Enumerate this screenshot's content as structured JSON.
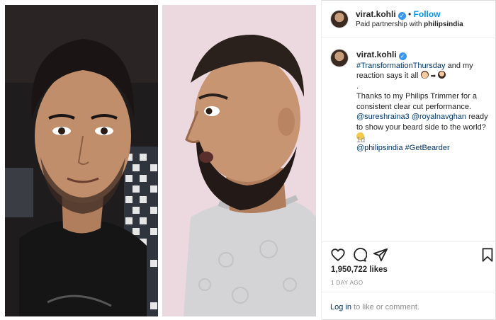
{
  "post": {
    "author": "virat.kohli",
    "follow_label": "Follow",
    "partnership_prefix": "Paid partnership with ",
    "partner": "philipsindia"
  },
  "caption": {
    "author": "virat.kohli",
    "hashtag_1": "#TransformationThursday",
    "line_1": "and my reaction says it all",
    "arrow": "➡",
    "dot": ".",
    "body": "Thanks to my Philips Trimmer for a consistent clear cut performance.",
    "mention_1": "@sureshraina3",
    "mention_2": "@royalnavghan",
    "body_2": "ready to show your beard side to the world?",
    "mention_3": "@philipsindia",
    "hashtag_2": "#GetBearder",
    "time_ago": "1d"
  },
  "engagement": {
    "likes": "1,950,722 likes",
    "date": "1 DAY AGO",
    "login_link": "Log in",
    "login_suffix": " to like or comment."
  },
  "colors": {
    "link_blue": "#0095f6",
    "verified": "#3897f0",
    "muted": "#8e8e8e",
    "right_photo_bg": "#ecd9e0"
  },
  "icons": [
    "heart-icon",
    "comment-icon",
    "share-icon",
    "bookmark-icon",
    "verified-badge-icon"
  ]
}
